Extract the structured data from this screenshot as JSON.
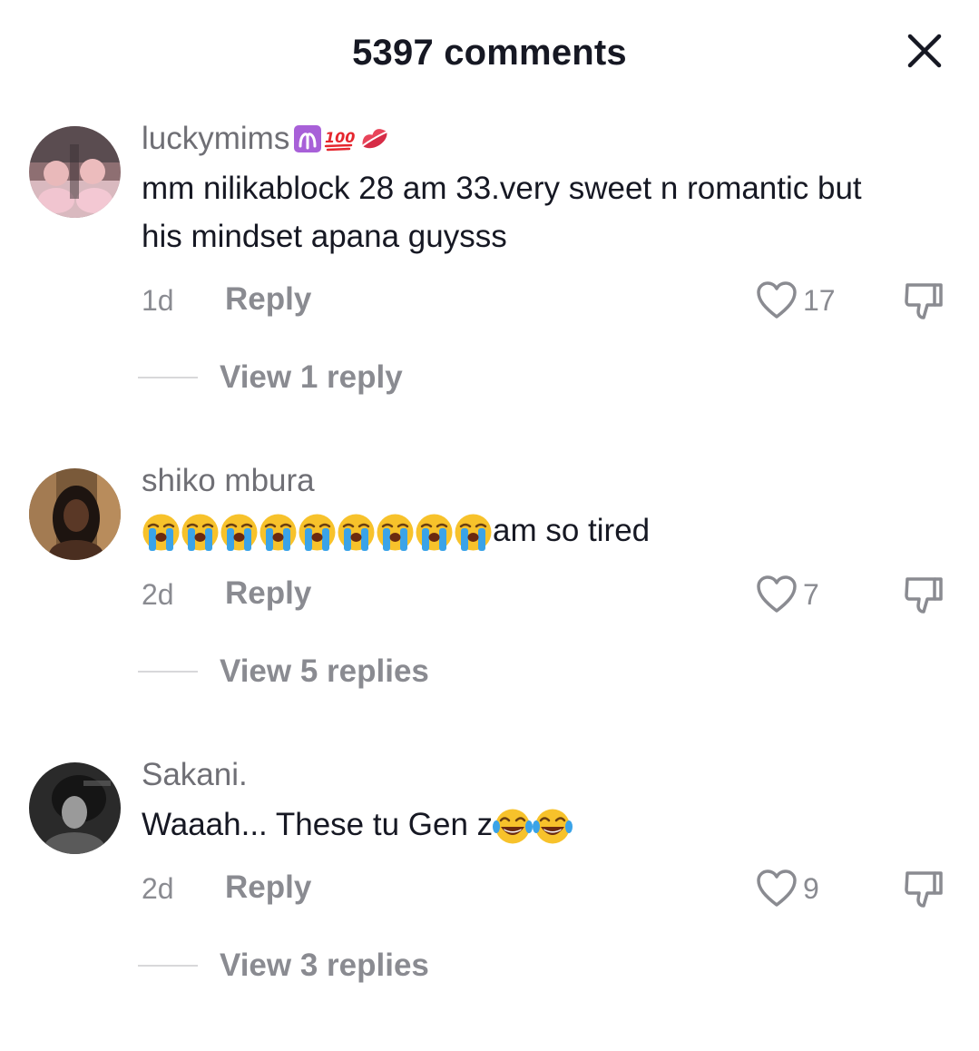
{
  "header": {
    "title": "5397 comments"
  },
  "comments": [
    {
      "username": "luckymims",
      "username_emojis": [
        "aries-sign",
        "hundred-points",
        "kiss-mark"
      ],
      "text_lines": [
        "mm nilikablock 28 am 33.very sweet n romantic but",
        "his mindset apana guysss"
      ],
      "time": "1d",
      "reply_label": "Reply",
      "likes": "17",
      "view_replies": "View 1 reply"
    },
    {
      "username": "shiko mbura",
      "emoji_prefix": "loudly-crying-face",
      "emoji_prefix_count": 9,
      "text": "am so tired",
      "time": "2d",
      "reply_label": "Reply",
      "likes": "7",
      "view_replies": "View 5 replies"
    },
    {
      "username": "Sakani.",
      "text": "Waaah... These tu Gen z",
      "emoji_suffix": "face-with-tears-of-joy",
      "emoji_suffix_count": 2,
      "time": "2d",
      "reply_label": "Reply",
      "likes": "9",
      "view_replies": "View 3 replies"
    }
  ],
  "colors": {
    "primary_text": "#161823",
    "secondary_text": "#8a8b91",
    "username_text": "#6f6f75",
    "divider": "#d8d8da",
    "background": "#ffffff"
  },
  "icons": {
    "close": "close-icon",
    "like": "heart-outline-icon",
    "dislike": "thumbs-down-icon"
  }
}
